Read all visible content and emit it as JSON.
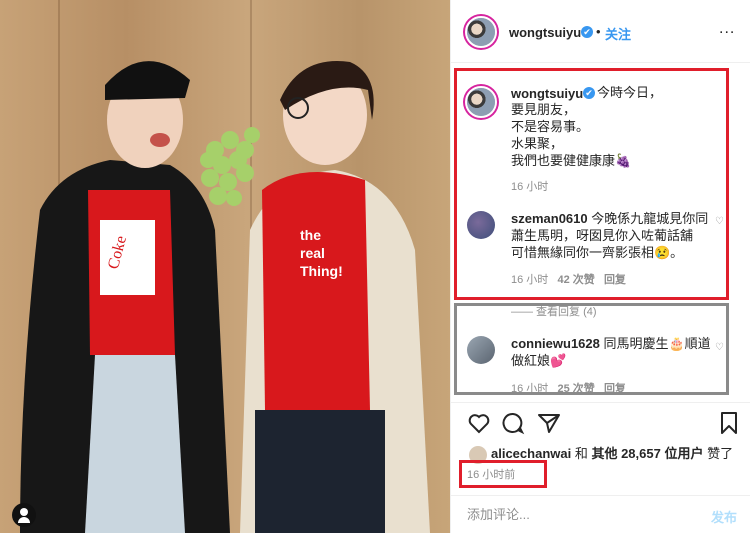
{
  "photo": {
    "alt": "two women in red hoodies holding grapes",
    "tag_icon": "person-tag-icon"
  },
  "header": {
    "username": "wongtsuiyu",
    "verified_mark": "✔",
    "follow_sep": "•",
    "follow_label": "关注",
    "more_label": "..."
  },
  "caption": {
    "username": "wongtsuiyu",
    "text": "今時今日，\n要見朋友，\n不是容易事。\n水果聚，\n我們也要健健康康🍇",
    "time": "16 小时"
  },
  "comments": [
    {
      "username": "szeman0610",
      "text": "今晚係九龍城見你同\n蕭生馬明，呀囡見你入咗葡話舖\n可惜無緣同你一齊影張相😢。",
      "time": "16 小时",
      "likes": "42 次赞",
      "reply": "回复"
    },
    {
      "username": "conniewu1628",
      "text": "同馬明慶生🎂順道\n做紅娘💕",
      "time": "16 小时",
      "likes": "25 次赞",
      "reply": "回复"
    }
  ],
  "view_replies": "—— 查看回复 (4)",
  "likes_line": {
    "user": "alicechanwai",
    "and": " 和 ",
    "others": "其他 28,657 位用户",
    "suffix": " 赞了"
  },
  "timestamp": "16 小时前",
  "add_comment": {
    "placeholder": "添加评论...",
    "post_label": "发布"
  },
  "colors": {
    "accent": "#3897f0",
    "highlight_red": "#e01e2b",
    "highlight_grey": "#8a8a8a"
  }
}
